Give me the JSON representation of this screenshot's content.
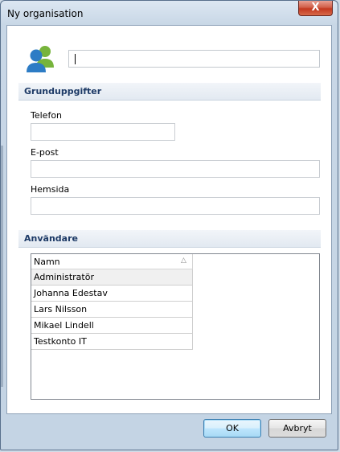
{
  "window": {
    "title": "Ny organisation",
    "close_symbol": "X"
  },
  "organisation": {
    "name_value": ""
  },
  "basic_info": {
    "header": "Grunduppgifter",
    "phone_label": "Telefon",
    "phone_value": "",
    "email_label": "E-post",
    "email_value": "",
    "website_label": "Hemsida",
    "website_value": ""
  },
  "users": {
    "header": "Användare",
    "column_header": "Namn",
    "sort_icon": "sort-ascending-icon",
    "rows": [
      "Administratör",
      "Johanna Edestav",
      "Lars Nilsson",
      "Mikael Lindell",
      "Testkonto IT"
    ]
  },
  "buttons": {
    "ok": "OK",
    "cancel": "Avbryt"
  },
  "colors": {
    "accent_blue": "#2d7cc5",
    "accent_green": "#77b43c",
    "section_text": "#1d3a66",
    "close_red": "#c3381f"
  }
}
